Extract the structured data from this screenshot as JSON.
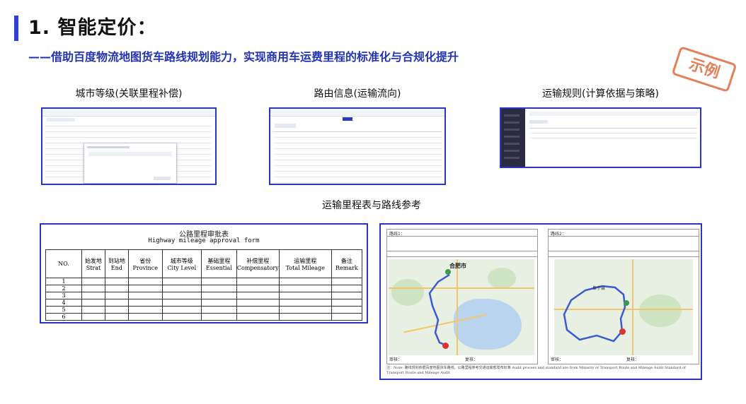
{
  "header": {
    "title": "1. 智能定价：",
    "subtitle": "——借助百度物流地图货车路线规划能力，实现商用车运费里程的标准化与合规化提升",
    "stamp": "示例"
  },
  "sections": {
    "city_grade": "城市等级(关联里程补偿)",
    "route_info": "路由信息(运输流向)",
    "transport_rules": "运输规则(计算依据与策略)",
    "mileage_reference": "运输里程表与路线参考"
  },
  "approval_form": {
    "title_cn": "公路里程审批表",
    "title_en": "Highway mileage approval form",
    "headers": [
      {
        "cn": "",
        "en": "NO."
      },
      {
        "cn": "始发地",
        "en": "Strat"
      },
      {
        "cn": "到站地",
        "en": "End"
      },
      {
        "cn": "省份",
        "en": "Province"
      },
      {
        "cn": "城市等级",
        "en": "City Level"
      },
      {
        "cn": "基础里程",
        "en": "Essential"
      },
      {
        "cn": "补偿里程",
        "en": "Compensatory"
      },
      {
        "cn": "运输里程",
        "en": "Total Mileage"
      },
      {
        "cn": "备注",
        "en": "Remark"
      }
    ],
    "rows": [
      "1",
      "2",
      "3",
      "4",
      "5",
      "6"
    ]
  },
  "route_sheet": {
    "left_header": "路线1：",
    "right_header": "路线2：",
    "left_city_label": "合肥市",
    "right_city_label": "阜宁县",
    "reviewer_label": "审核：",
    "reviewer2_label": "复核：",
    "note": "注：Note: 路线规划依据百度地图货车路线，公路里程参考交通运输部发布标准 Audit process and standard are from Ministry of Transport Route and Mileage Audit Standard of Transport Route and Mileage Audit"
  },
  "colors": {
    "accent": "#2b36c9",
    "title_bar": "#2f3fd0",
    "subtitle": "#2233b8",
    "stamp": "#e06a3c",
    "route": "#3b5bd6"
  }
}
